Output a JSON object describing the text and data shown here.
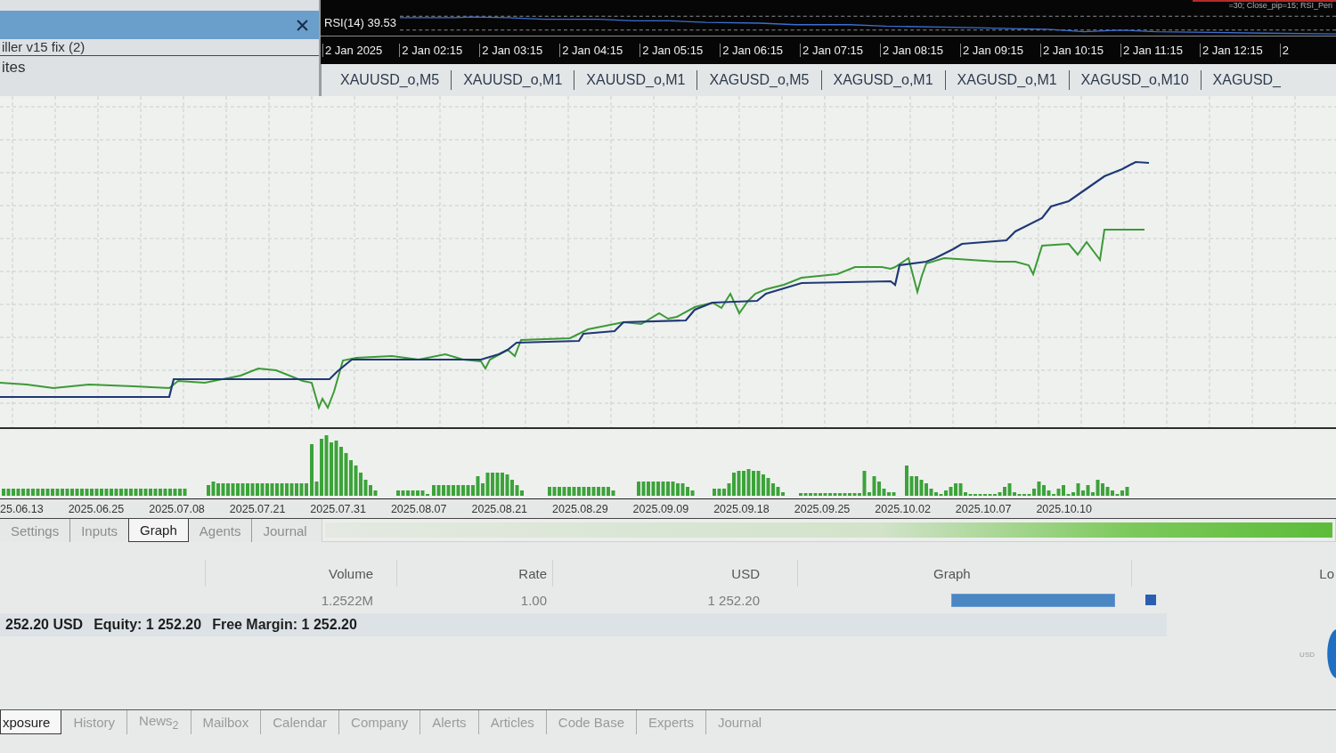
{
  "navigator": {
    "items": [
      "iller v15 fix (2)",
      "ites"
    ]
  },
  "chart_window": {
    "caption": "=30; Close_pip=15; RSI_Peri",
    "indicator": {
      "label": "RSI(14) 39.53"
    },
    "time_axis": [
      "2 Jan 2025",
      "2 Jan 02:15",
      "2 Jan 03:15",
      "2 Jan 04:15",
      "2 Jan 05:15",
      "2 Jan 06:15",
      "2 Jan 07:15",
      "2 Jan 08:15",
      "2 Jan 09:15",
      "2 Jan 10:15",
      "2 Jan 11:15",
      "2 Jan 12:15",
      "2"
    ],
    "tabs": [
      {
        "label": "XAUUSD_o,M5",
        "selected": false
      },
      {
        "label": "XAUUSD_o,M1",
        "selected": false
      },
      {
        "label": "XAUUSD_o,M1",
        "selected": false
      },
      {
        "label": "XAGUSD_o,M5",
        "selected": false
      },
      {
        "label": "XAGUSD_o,M1",
        "selected": false
      },
      {
        "label": "XAGUSD_o,M1",
        "selected": false
      },
      {
        "label": "XAGUSD_o,M10",
        "selected": false
      },
      {
        "label": "XAGUSD_",
        "selected": false
      }
    ]
  },
  "tester": {
    "graph": {
      "date_axis": [
        "25.06.13",
        "2025.06.25",
        "2025.07.08",
        "2025.07.21",
        "2025.07.31",
        "2025.08.07",
        "2025.08.21",
        "2025.08.29",
        "2025.09.09",
        "2025.09.18",
        "2025.09.25",
        "2025.10.02",
        "2025.10.07",
        "2025.10.10"
      ]
    },
    "tabs": [
      {
        "label": "Settings",
        "selected": false
      },
      {
        "label": "Inputs",
        "selected": false
      },
      {
        "label": "Graph",
        "selected": true
      },
      {
        "label": "Agents",
        "selected": false
      },
      {
        "label": "Journal",
        "selected": false
      }
    ],
    "progress": {
      "level": 1
    }
  },
  "toolbox": {
    "columns": [
      "Volume",
      "Rate",
      "USD",
      "Graph",
      "Lo"
    ],
    "rows": [
      [
        "1.2522M",
        "1.00",
        "1 252.20"
      ]
    ],
    "summary": [
      "252.20 USD",
      "Equity: 1 252.20",
      "Free Margin: 1 252.20"
    ],
    "currency_badge": "USD",
    "tabs": [
      {
        "label": "xposure",
        "selected": true
      },
      {
        "label": "History",
        "selected": false
      },
      {
        "label": "News$_{2}$",
        "selected": false
      },
      {
        "label": "Mailbox",
        "selected": false
      },
      {
        "label": "Calendar",
        "selected": false
      },
      {
        "label": "Company",
        "selected": false
      },
      {
        "label": "Alerts",
        "selected": false
      },
      {
        "label": "Articles",
        "selected": false
      },
      {
        "label": "Code Base",
        "selected": false
      },
      {
        "label": "Experts",
        "selected": false
      },
      {
        "label": "Journal",
        "selected": false
      }
    ]
  }
}
